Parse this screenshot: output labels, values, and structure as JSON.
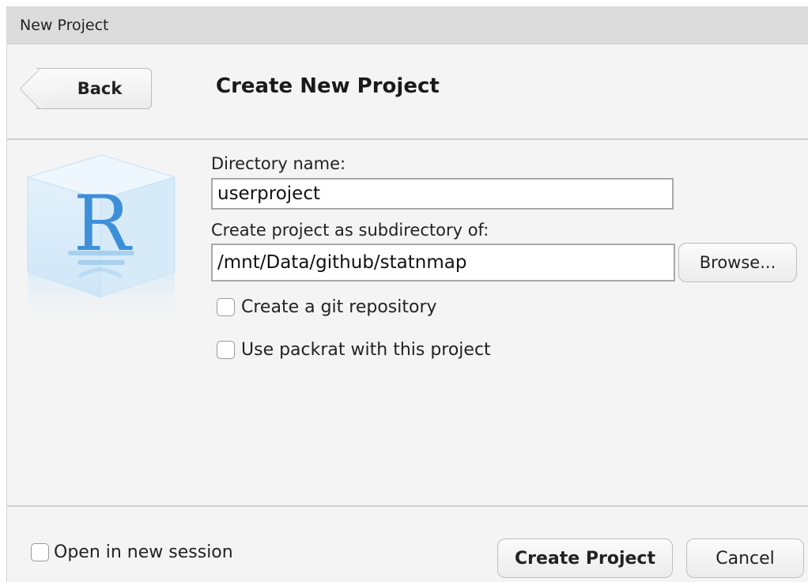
{
  "window": {
    "title": "New Project"
  },
  "header": {
    "back_label": "Back",
    "title": "Create New Project"
  },
  "logo": {
    "letter": "R",
    "icon": "r-cube-logo"
  },
  "form": {
    "directory_label": "Directory name:",
    "directory_value": "userproject",
    "parent_label": "Create project as subdirectory of:",
    "parent_value": "/mnt/Data/github/statnmap",
    "browse_label": "Browse...",
    "git_label": "Create a git repository",
    "git_checked": false,
    "packrat_label": "Use packrat with this project",
    "packrat_checked": false
  },
  "footer": {
    "new_session_label": "Open in new session",
    "new_session_checked": false,
    "create_label": "Create Project",
    "cancel_label": "Cancel"
  }
}
